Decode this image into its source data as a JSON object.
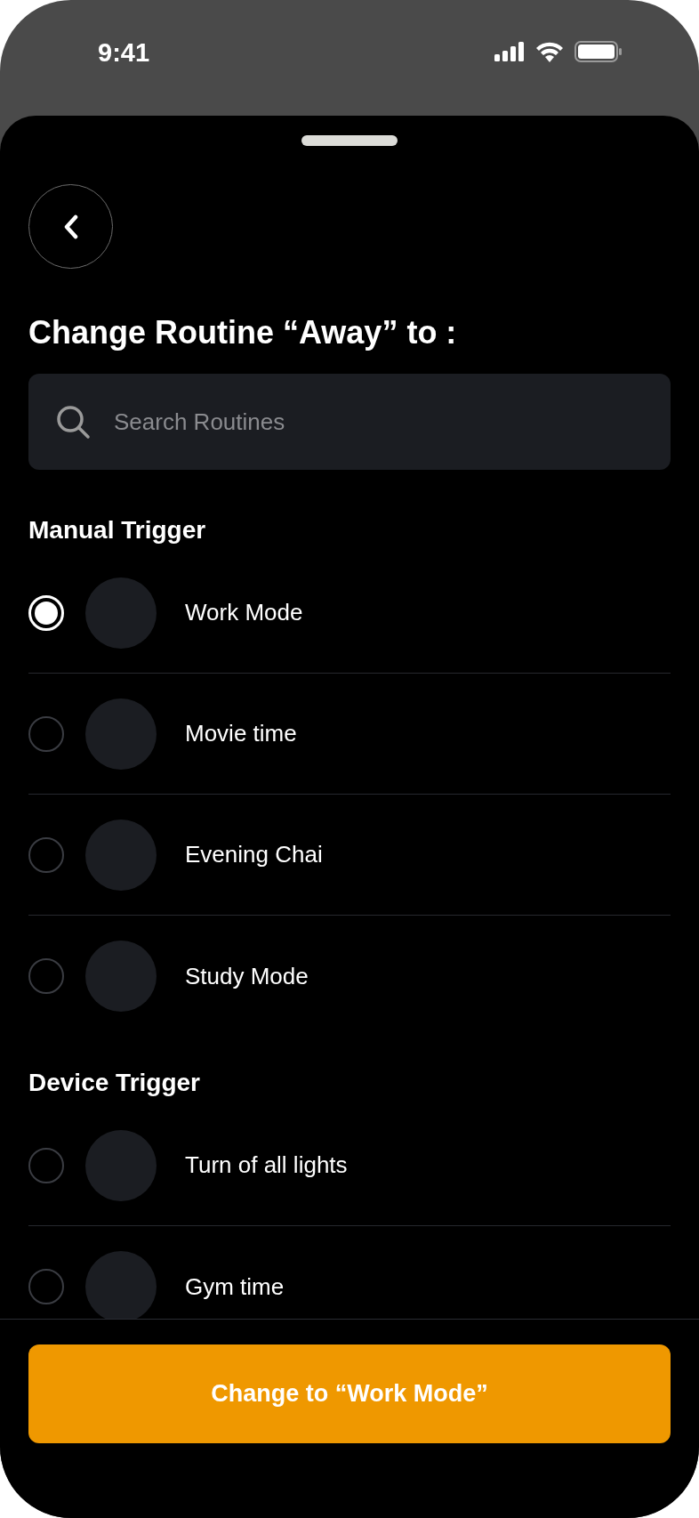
{
  "status_bar": {
    "time": "9:41"
  },
  "title": "Change Routine “Away” to :",
  "search": {
    "placeholder": "Search Routines"
  },
  "sections": [
    {
      "title": "Manual Trigger",
      "items": [
        {
          "label": "Work Mode",
          "selected": true
        },
        {
          "label": "Movie time",
          "selected": false
        },
        {
          "label": "Evening Chai",
          "selected": false
        },
        {
          "label": "Study Mode",
          "selected": false
        }
      ]
    },
    {
      "title": "Device Trigger",
      "items": [
        {
          "label": "Turn of all lights",
          "selected": false
        },
        {
          "label": "Gym time",
          "selected": false
        }
      ]
    }
  ],
  "primary_button": "Change to “Work Mode”"
}
